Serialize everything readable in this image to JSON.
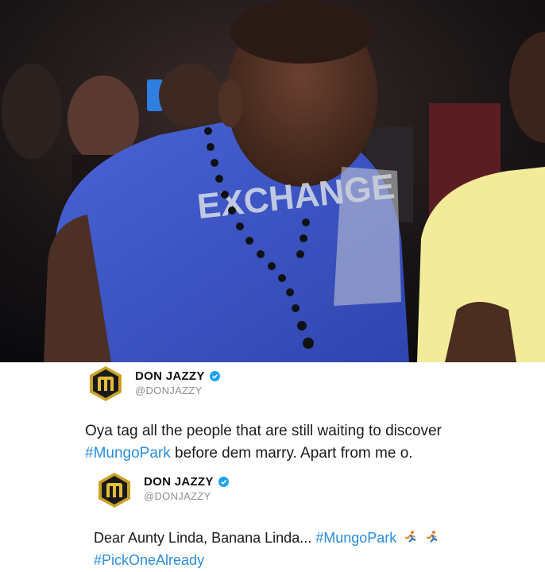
{
  "photo": {
    "description_icon": "party-photo",
    "shirt_text": "EXCHANGE"
  },
  "tweet1": {
    "display_name": "DON JAZZY",
    "handle": "@DONJAZZY",
    "text_part1": "Oya tag all the people that are still waiting to discover",
    "hashtag": "#MungoPark",
    "text_part2": " before dem marry. Apart from me o."
  },
  "tweet2": {
    "display_name": "DON JAZZY",
    "handle": "@DONJAZZY",
    "text_part1": "Dear Aunty Linda, Banana Linda... ",
    "hashtag1": "#MungoPark",
    "hashtag2": "#PickOneAlready",
    "emoji_icon": "running-man-icon"
  },
  "colors": {
    "link": "#2a8ee0",
    "verified": "#1da1f2",
    "shirt": "#3e57c9",
    "avatar_gold": "#c9a227"
  }
}
